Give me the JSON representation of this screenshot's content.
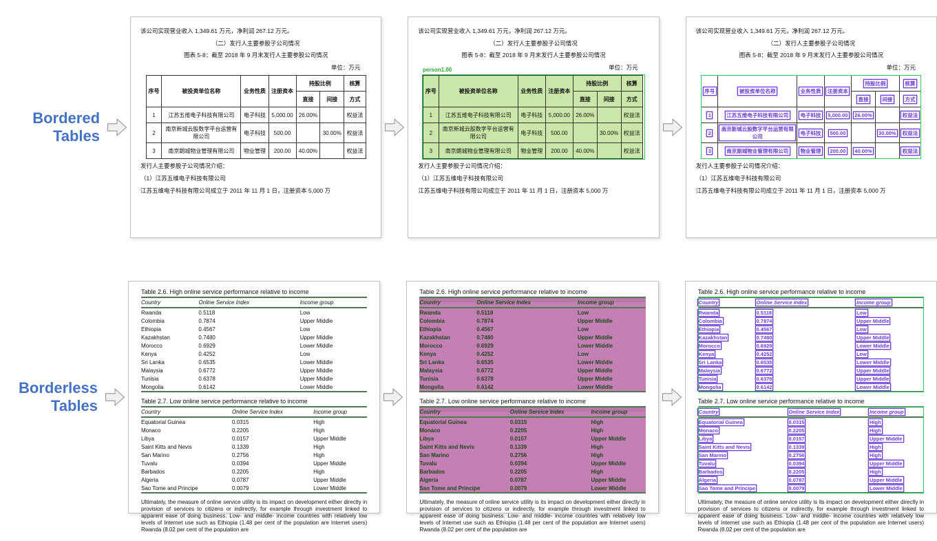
{
  "labels": {
    "bordered": "Bordered\nTables",
    "borderless": "Borderless\nTables"
  },
  "cn": {
    "p1": "该公司实现营业收入 1,349.61 万元，净利润 267.12 万元。",
    "p2": "（二）发行人主要参股子公司情况",
    "p3": "图表 5-8：截至 2018 年 9 月末发行人主要参股公司情况",
    "p4": "单位：万元",
    "headers": [
      "序号",
      "被投资单位名称",
      "业务性质",
      "注册资本",
      "持股比例",
      "核算"
    ],
    "subheaders": [
      "直接",
      "间接",
      "方式"
    ],
    "rows": [
      [
        "1",
        "江苏五维电子科技有限公司",
        "电子科技",
        "5,000.00",
        "26.00%",
        "",
        "权益法"
      ],
      [
        "2",
        "南京新城云股数字平台运营有限公司",
        "电子科技",
        "500.00",
        "",
        "30.00%",
        "权益法"
      ],
      [
        "3",
        "南京朗城物业管理有限公司",
        "物业管理",
        "200.00",
        "40.00%",
        "",
        "权益法"
      ]
    ],
    "p5": "发行人主要参股子公司情况介绍：",
    "p6": "（1）江苏五维电子科技有限公司",
    "p7": "江苏五维电子科技有限公司成立于 2011 年 11 月 1 日，注册资本 5,000 万"
  },
  "en": {
    "cap26": "Table 2.6.   High online service performance relative to income",
    "cap27": "Table 2.7.   Low online service performance relative to income",
    "cols": [
      "Country",
      "Online Service Index",
      "Income group"
    ],
    "t26": [
      [
        "Rwanda",
        "0.5118",
        "Low"
      ],
      [
        "Colombia",
        "0.7874",
        "Upper Middle"
      ],
      [
        "Ethiopia",
        "0.4567",
        "Low"
      ],
      [
        "Kazakhstan",
        "0.7480",
        "Upper Middle"
      ],
      [
        "Morocco",
        "0.6929",
        "Lower Middle"
      ],
      [
        "Kenya",
        "0.4252",
        "Low"
      ],
      [
        "Sri Lanka",
        "0.6535",
        "Lower Middle"
      ],
      [
        "Malaysia",
        "0.6772",
        "Upper Middle"
      ],
      [
        "Tunisia",
        "0.6378",
        "Upper Middle"
      ],
      [
        "Mongolia",
        "0.6142",
        "Lower Middle"
      ]
    ],
    "t27": [
      [
        "Equatorial Guinea",
        "0.0315",
        "High"
      ],
      [
        "Monaco",
        "0.2205",
        "High"
      ],
      [
        "Libya",
        "0.0157",
        "Upper Middle"
      ],
      [
        "Saint Kitts and Nevis",
        "0.1339",
        "High"
      ],
      [
        "San Marino",
        "0.2756",
        "High"
      ],
      [
        "Tuvalu",
        "0.0394",
        "Upper Middle"
      ],
      [
        "Barbados",
        "0.2205",
        "High"
      ],
      [
        "Algeria",
        "0.0787",
        "Upper Middle"
      ],
      [
        "Sao Tome and Principe",
        "0.0079",
        "Lower Middle"
      ]
    ],
    "para": "Ultimately, the measure of online service utility is its impact on development either directly in provision of services to citizens or indirectly, for example through investment linked to apparent ease of doing business. Low- and middle- income countries with relatively low levels of Internet use such as Ethiopia (1.48 per cent of the population are Internet users)  Rwanda (8.02 per cent of the population are"
  }
}
